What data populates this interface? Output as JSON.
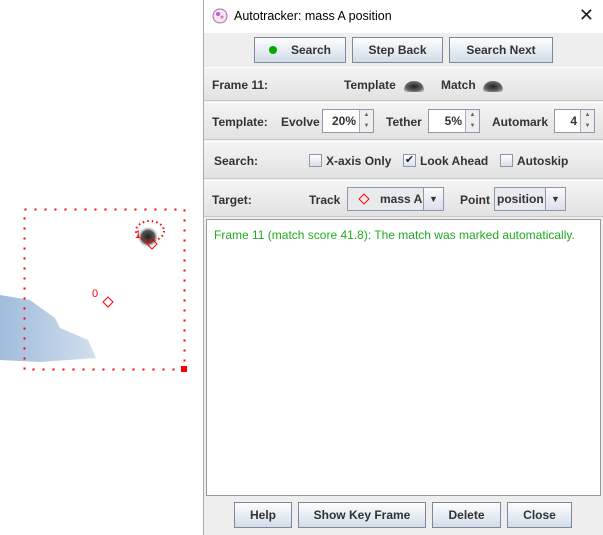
{
  "window": {
    "title": "Autotracker: mass A position",
    "close": "✕"
  },
  "toolbar": {
    "search": "Search",
    "step_back": "Step Back",
    "search_next": "Search Next",
    "search_indicator_color": "#00aa00"
  },
  "frame_row": {
    "label": "Frame 11:",
    "template": "Template",
    "match": "Match"
  },
  "template_row": {
    "label": "Template:",
    "evolve_label": "Evolve",
    "evolve": "20%",
    "tether_label": "Tether",
    "tether": "5%",
    "automark_label": "Automark",
    "automark": "4"
  },
  "search_row": {
    "label": "Search:",
    "x_axis_only": "X-axis Only",
    "x_axis_only_checked": false,
    "look_ahead": "Look Ahead",
    "look_ahead_checked": true,
    "autoskip": "Autoskip",
    "autoskip_checked": false
  },
  "target_row": {
    "label": "Target:",
    "track_label": "Track",
    "track": "mass A",
    "point_label": "Point",
    "point": "position"
  },
  "message": "Frame 11 (match score 41.8): The match was marked automatically.",
  "bottom": {
    "help": "Help",
    "show_key_frame": "Show Key Frame",
    "delete": "Delete",
    "close": "Close"
  },
  "canvas": {
    "marker_labels": [
      "0",
      "1"
    ],
    "marker_color": "#ff0000"
  }
}
